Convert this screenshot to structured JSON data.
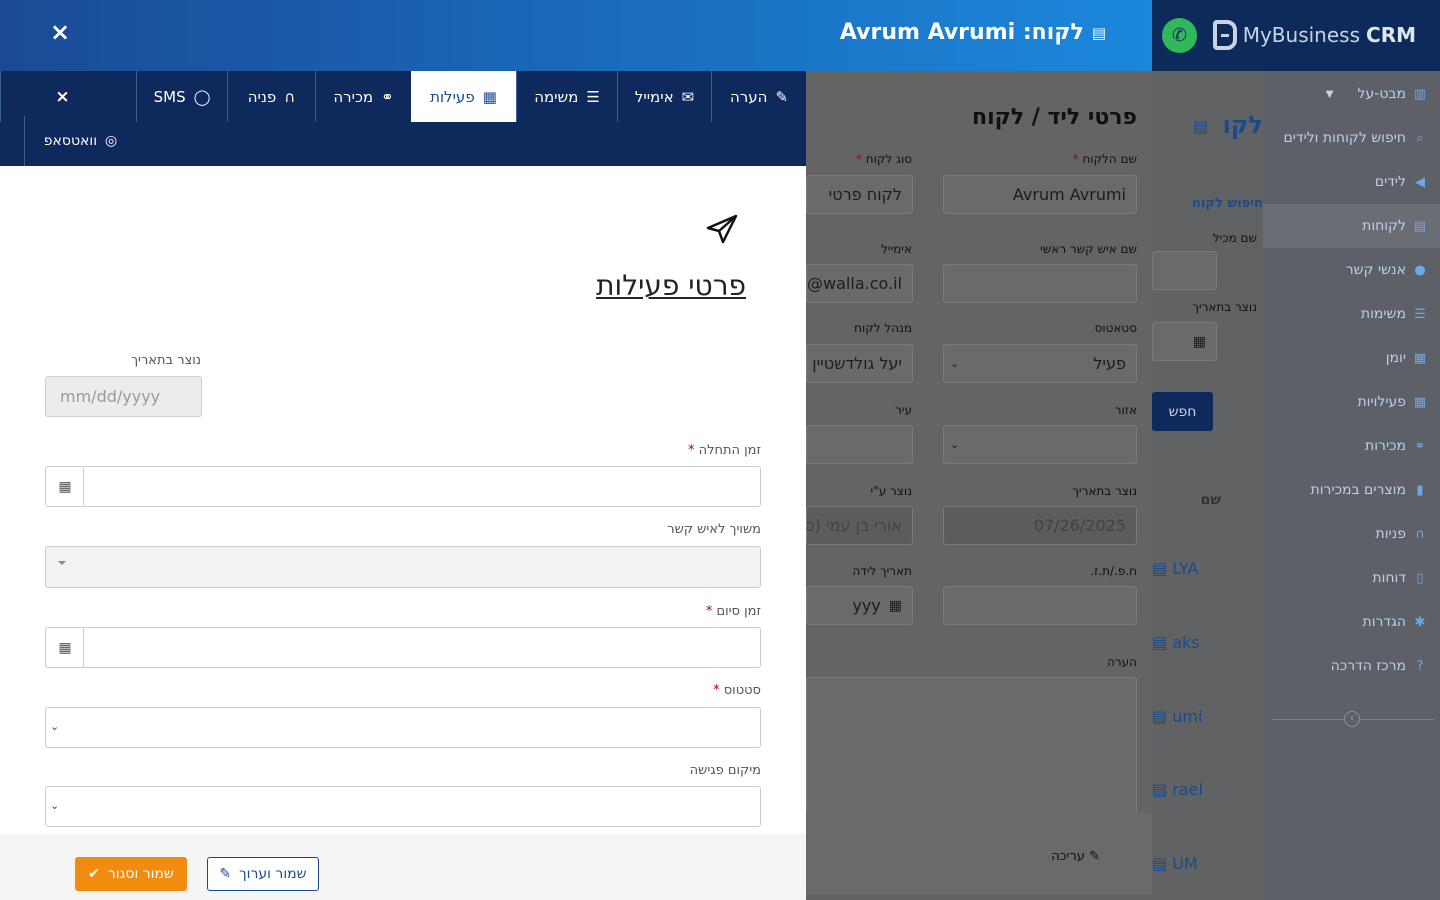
{
  "app": {
    "logo_text": "MyBusiness",
    "logo_bold": "CRM"
  },
  "sidebar": {
    "items": [
      {
        "label": "מבט-על",
        "icon": "bar-chart-icon"
      },
      {
        "label": "חיפוש לקוחות ולידים",
        "icon": "search-icon"
      },
      {
        "label": "לידים",
        "icon": "megaphone-icon"
      },
      {
        "label": "לקוחות",
        "icon": "building-icon"
      },
      {
        "label": "אנשי קשר",
        "icon": "user-icon"
      },
      {
        "label": "משימות",
        "icon": "list-icon"
      },
      {
        "label": "יומן",
        "icon": "calendar-icon"
      },
      {
        "label": "פעילויות",
        "icon": "calendar-icon"
      },
      {
        "label": "מכירות",
        "icon": "handshake-icon"
      },
      {
        "label": "מוצרים במכירות",
        "icon": "barcode-icon"
      },
      {
        "label": "פניות",
        "icon": "headset-icon"
      },
      {
        "label": "דוחות",
        "icon": "file-icon"
      },
      {
        "label": "הגדרות",
        "icon": "gear-icon"
      },
      {
        "label": "מרכז הדרכה",
        "icon": "question-icon"
      }
    ],
    "toggle_glyph": "‹"
  },
  "background": {
    "page_title": "לקו",
    "search_section": "חיפוש לקוח",
    "search_field_label": "שם מכיל",
    "created_label": "נוצר בתאריך",
    "search_button": "חפש",
    "column_name": "שם",
    "rows": [
      "LYA",
      "aks",
      "umi",
      "rael",
      "UM"
    ],
    "card_title": "פרטי ליד / לקוח",
    "fields": {
      "customer_name_label": "שם הלקוח",
      "customer_name_value": "Avrum Avrumi",
      "customer_type_label": "סוג לקוח",
      "customer_type_value": "לקוח פרטי",
      "main_contact_label": "שם איש קשר ראשי",
      "email_label": "אימייל",
      "email_value": "i@walla.co.il",
      "status_label": "סטאטוס",
      "status_value": "פעיל",
      "manager_label": "מנהל לקוח",
      "manager_value": "יעל גולדשטיין",
      "region_label": "אזור",
      "city_label": "עיר",
      "created_date_label": "נוצר בתאריך",
      "created_date_value": "07/26/2025",
      "created_by_label": "נוצר ע\"י",
      "created_by_value": "אורי בן עמי (ס",
      "id_label": "ח.פ./ת.ז.",
      "birth_label": "תאריך לידה",
      "birth_value": "yyy",
      "note_label": "הערה",
      "edit_label": "עריכה"
    }
  },
  "modal": {
    "title": "לקוח: Avrum Avrumi",
    "close_glyph": "×",
    "tabs": [
      {
        "label": "הערה",
        "icon": "edit-icon"
      },
      {
        "label": "אימייל",
        "icon": "envelope-icon"
      },
      {
        "label": "משימה",
        "icon": "list-icon"
      },
      {
        "label": "פעילות",
        "icon": "calendar-icon"
      },
      {
        "label": "מכירה",
        "icon": "handshake-icon"
      },
      {
        "label": "פניה",
        "icon": "headset-icon"
      },
      {
        "label": "SMS",
        "icon": "comment-icon"
      }
    ],
    "tab_whatsapp": {
      "label": "וואטסאפ",
      "icon": "comments-icon"
    },
    "tab_close_glyph": "×",
    "section_title": "פרטי פעילות",
    "form": {
      "created_label": "נוצר בתאריך",
      "created_placeholder": "mm/dd/yyyy",
      "start_label": "זמן התחלה",
      "contact_label": "משויך לאיש קשר",
      "end_label": "זמן סיום",
      "status_label": "סטטוס",
      "location_label": "מיקום פגישה",
      "required_mark": "*"
    },
    "buttons": {
      "save_close": "שמור וסגור",
      "save_edit": "שמור וערוך"
    }
  },
  "colors": {
    "brand_dark": "#0e2a5c",
    "brand_blue": "#1a4a96",
    "accent_orange": "#f28c10",
    "whatsapp_green": "#31b85a"
  }
}
